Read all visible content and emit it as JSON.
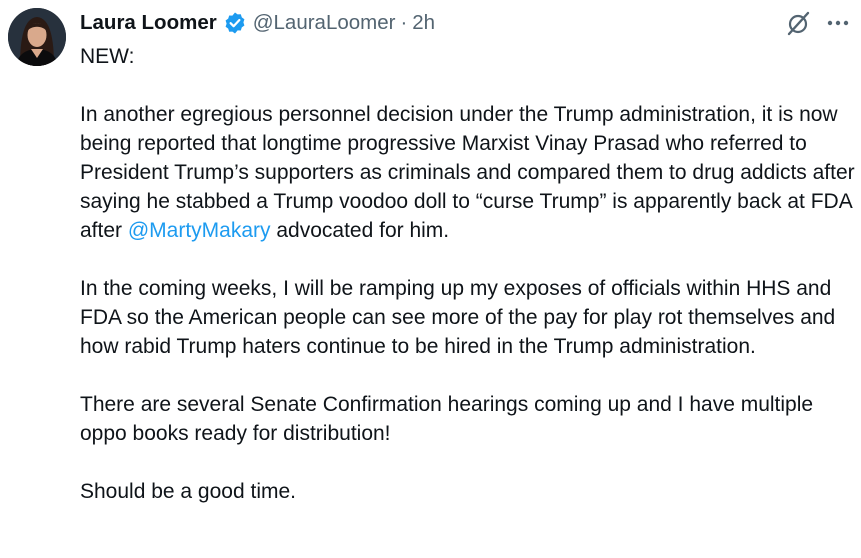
{
  "author": {
    "name": "Laura Loomer",
    "handle": "@LauraLoomer",
    "separator": "·",
    "time": "2h",
    "verified": true,
    "verified_icon": "verified-badge-icon",
    "colors": {
      "verified": "#1d9bf0",
      "muted": "#536471",
      "link": "#1d9bf0"
    }
  },
  "actions": {
    "grok_icon": "slashed-circle-icon",
    "more_icon": "ellipsis-icon"
  },
  "post": {
    "line1": "NEW:",
    "p1_before": "In another egregious personnel decision under the Trump administration, it is now being reported that longtime progressive Marxist Vinay Prasad who referred to President Trump’s supporters as criminals and compared them to drug addicts after saying he stabbed a Trump voodoo doll to “curse Trump” is apparently back at FDA after ",
    "p1_mention": "@MartyMakary",
    "p1_after": " advocated for him.",
    "p2": "In the coming weeks, I will be ramping up my exposes of officials within HHS and FDA so the American people can see more of the pay for play rot themselves and how rabid Trump haters continue to be hired in the Trump administration.",
    "p3": "There are several Senate Confirmation hearings coming up and I have multiple oppo books ready for distribution!",
    "p4": "Should be a good time."
  }
}
